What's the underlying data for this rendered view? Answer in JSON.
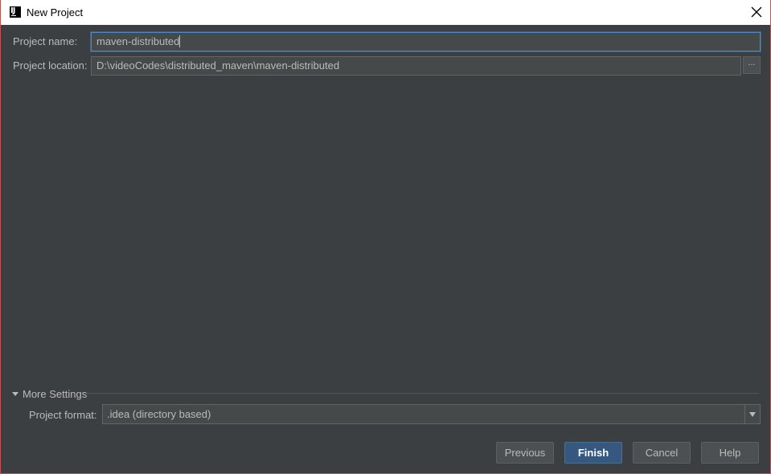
{
  "window": {
    "title": "New Project",
    "app_icon_text": "IJ"
  },
  "form": {
    "project_name_label": "Project name:",
    "project_name_value": "maven-distributed",
    "project_location_label": "Project location:",
    "project_location_value": "D:\\videoCodes\\distributed_maven\\maven-distributed",
    "browse_label": "..."
  },
  "more_settings": {
    "label": "More Settings",
    "project_format_label": "Project format:",
    "project_format_value": ".idea (directory based)"
  },
  "buttons": {
    "previous": "Previous",
    "finish": "Finish",
    "cancel": "Cancel",
    "help": "Help"
  },
  "colors": {
    "background": "#3c3f41",
    "field_background": "#45494a",
    "focus_border": "#4a88c7",
    "default_button": "#365880",
    "text": "#bbbbbb"
  },
  "icons": {
    "app": "intellij-icon",
    "close": "close-icon",
    "expand": "triangle-down-icon",
    "dropdown": "chevron-down-icon"
  }
}
